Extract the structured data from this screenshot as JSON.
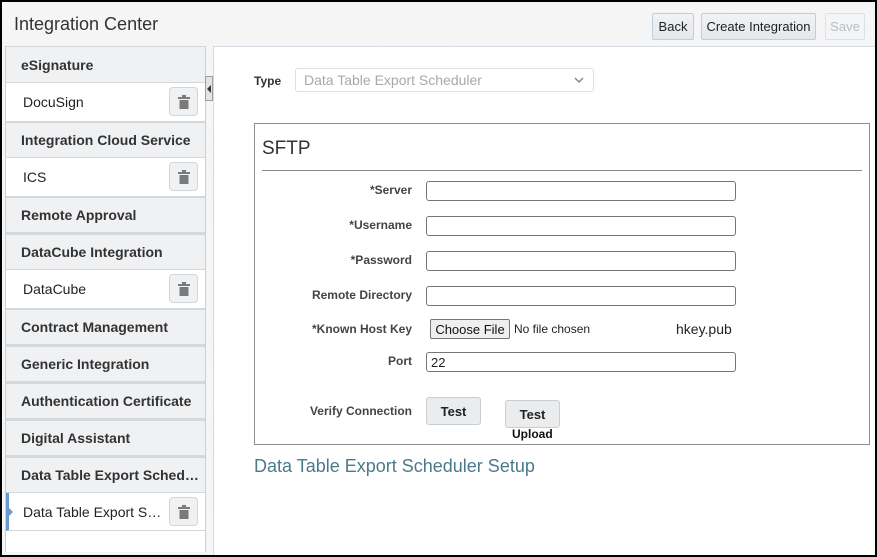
{
  "header": {
    "title": "Integration Center",
    "buttons": {
      "back": "Back",
      "create": "Create Integration",
      "save": "Save"
    }
  },
  "sidebar": {
    "groups": [
      {
        "label": "eSignature",
        "items": [
          {
            "label": "DocuSign",
            "selected": false
          }
        ]
      },
      {
        "label": "Integration Cloud Service",
        "items": [
          {
            "label": "ICS",
            "selected": false
          }
        ]
      },
      {
        "label": "Remote Approval",
        "items": []
      },
      {
        "label": "DataCube Integration",
        "items": [
          {
            "label": "DataCube",
            "selected": false
          }
        ]
      },
      {
        "label": "Contract Management",
        "items": []
      },
      {
        "label": "Generic Integration",
        "items": []
      },
      {
        "label": "Authentication Certificate",
        "items": []
      },
      {
        "label": "Digital Assistant",
        "items": []
      },
      {
        "label": "Data Table Export Scheduler",
        "items": [
          {
            "label": "Data Table Export Scheduler",
            "selected": true
          }
        ]
      }
    ],
    "delete_icon": "trash-icon"
  },
  "main": {
    "type": {
      "label": "Type",
      "value": "Data Table Export Scheduler"
    },
    "sftp": {
      "title": "SFTP",
      "fields": {
        "server": {
          "label": "*Server",
          "value": ""
        },
        "username": {
          "label": "*Username",
          "value": ""
        },
        "password": {
          "label": "*Password",
          "value": ""
        },
        "remote_directory": {
          "label": "Remote Directory",
          "value": ""
        },
        "known_host_key": {
          "label": "*Known Host Key",
          "choose_file": "Choose File",
          "no_file": "No file chosen",
          "current_file": "hkey.pub"
        },
        "port": {
          "label": "Port",
          "value": "22"
        }
      },
      "verify": {
        "label": "Verify Connection",
        "test": "Test",
        "test_upload_line1": "Test",
        "test_upload_line2": "Upload"
      }
    },
    "setup_title": "Data Table Export Scheduler Setup"
  },
  "colors": {
    "selected_accent": "#6a9ad0",
    "setup_title": "#4a7a8c"
  }
}
